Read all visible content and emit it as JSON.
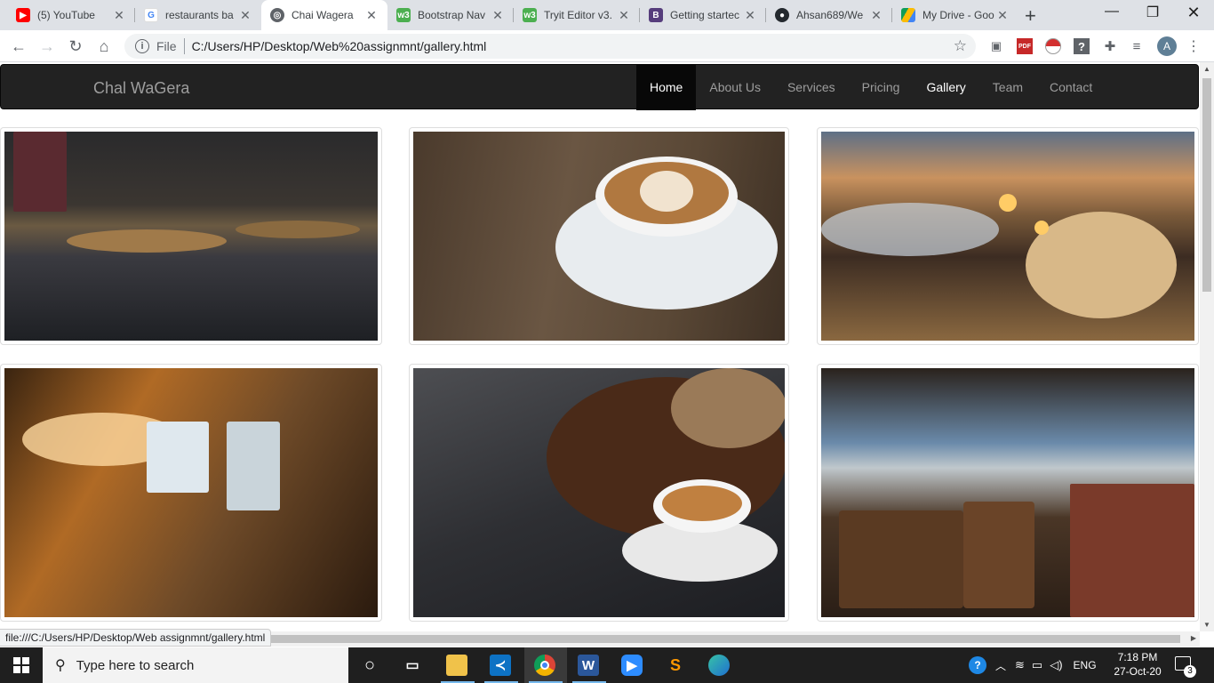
{
  "browser": {
    "tabs": [
      {
        "title": "(5) YouTube",
        "favicon": "youtube-icon",
        "color": "#ff0000"
      },
      {
        "title": "restaurants ba",
        "favicon": "google-icon",
        "color": "#4285f4"
      },
      {
        "title": "Chai Wagera",
        "favicon": "globe-icon",
        "color": "#5f6368"
      },
      {
        "title": "Bootstrap Nav",
        "favicon": "w3schools-icon",
        "color": "#4caf50"
      },
      {
        "title": "Tryit Editor v3.",
        "favicon": "w3schools-icon",
        "color": "#4caf50"
      },
      {
        "title": "Getting startec",
        "favicon": "bootstrap-icon",
        "color": "#563d7c"
      },
      {
        "title": "Ahsan689/We",
        "favicon": "github-icon",
        "color": "#24292e"
      },
      {
        "title": "My Drive - Goo",
        "favicon": "google-drive-icon",
        "color": "#fbbc04"
      }
    ],
    "active_tab": 2,
    "omnibox": {
      "scheme_label": "File",
      "url": "C:/Users/HP/Desktop/Web%20assignmnt/gallery.html"
    },
    "profile_initial": "A",
    "status_url": "file:///C:/Users/HP/Desktop/Web assignmnt/gallery.html"
  },
  "site": {
    "brand": "Chal WaGera",
    "nav": [
      {
        "label": "Home",
        "state": "active"
      },
      {
        "label": "About Us",
        "state": "normal"
      },
      {
        "label": "Services",
        "state": "normal"
      },
      {
        "label": "Pricing",
        "state": "normal"
      },
      {
        "label": "Gallery",
        "state": "bright"
      },
      {
        "label": "Team",
        "state": "normal"
      },
      {
        "label": "Contact",
        "state": "normal"
      }
    ],
    "gallery": [
      {
        "subject": "restaurant-interior-photo"
      },
      {
        "subject": "latte-art-coffee-photo"
      },
      {
        "subject": "beach-dinner-photo"
      },
      {
        "subject": "lounge-bar-photo"
      },
      {
        "subject": "coffee-beans-photo"
      },
      {
        "subject": "rooftop-terrace-photo"
      }
    ]
  },
  "taskbar": {
    "search_placeholder": "Type here to search",
    "language": "ENG",
    "time": "7:18 PM",
    "date": "27-Oct-20",
    "notification_count": "3",
    "pinned": [
      "cortana-icon",
      "task-view-icon",
      "file-explorer-icon",
      "vscode-icon",
      "chrome-icon",
      "word-icon",
      "zoom-icon",
      "sublime-icon",
      "edge-icon"
    ]
  }
}
